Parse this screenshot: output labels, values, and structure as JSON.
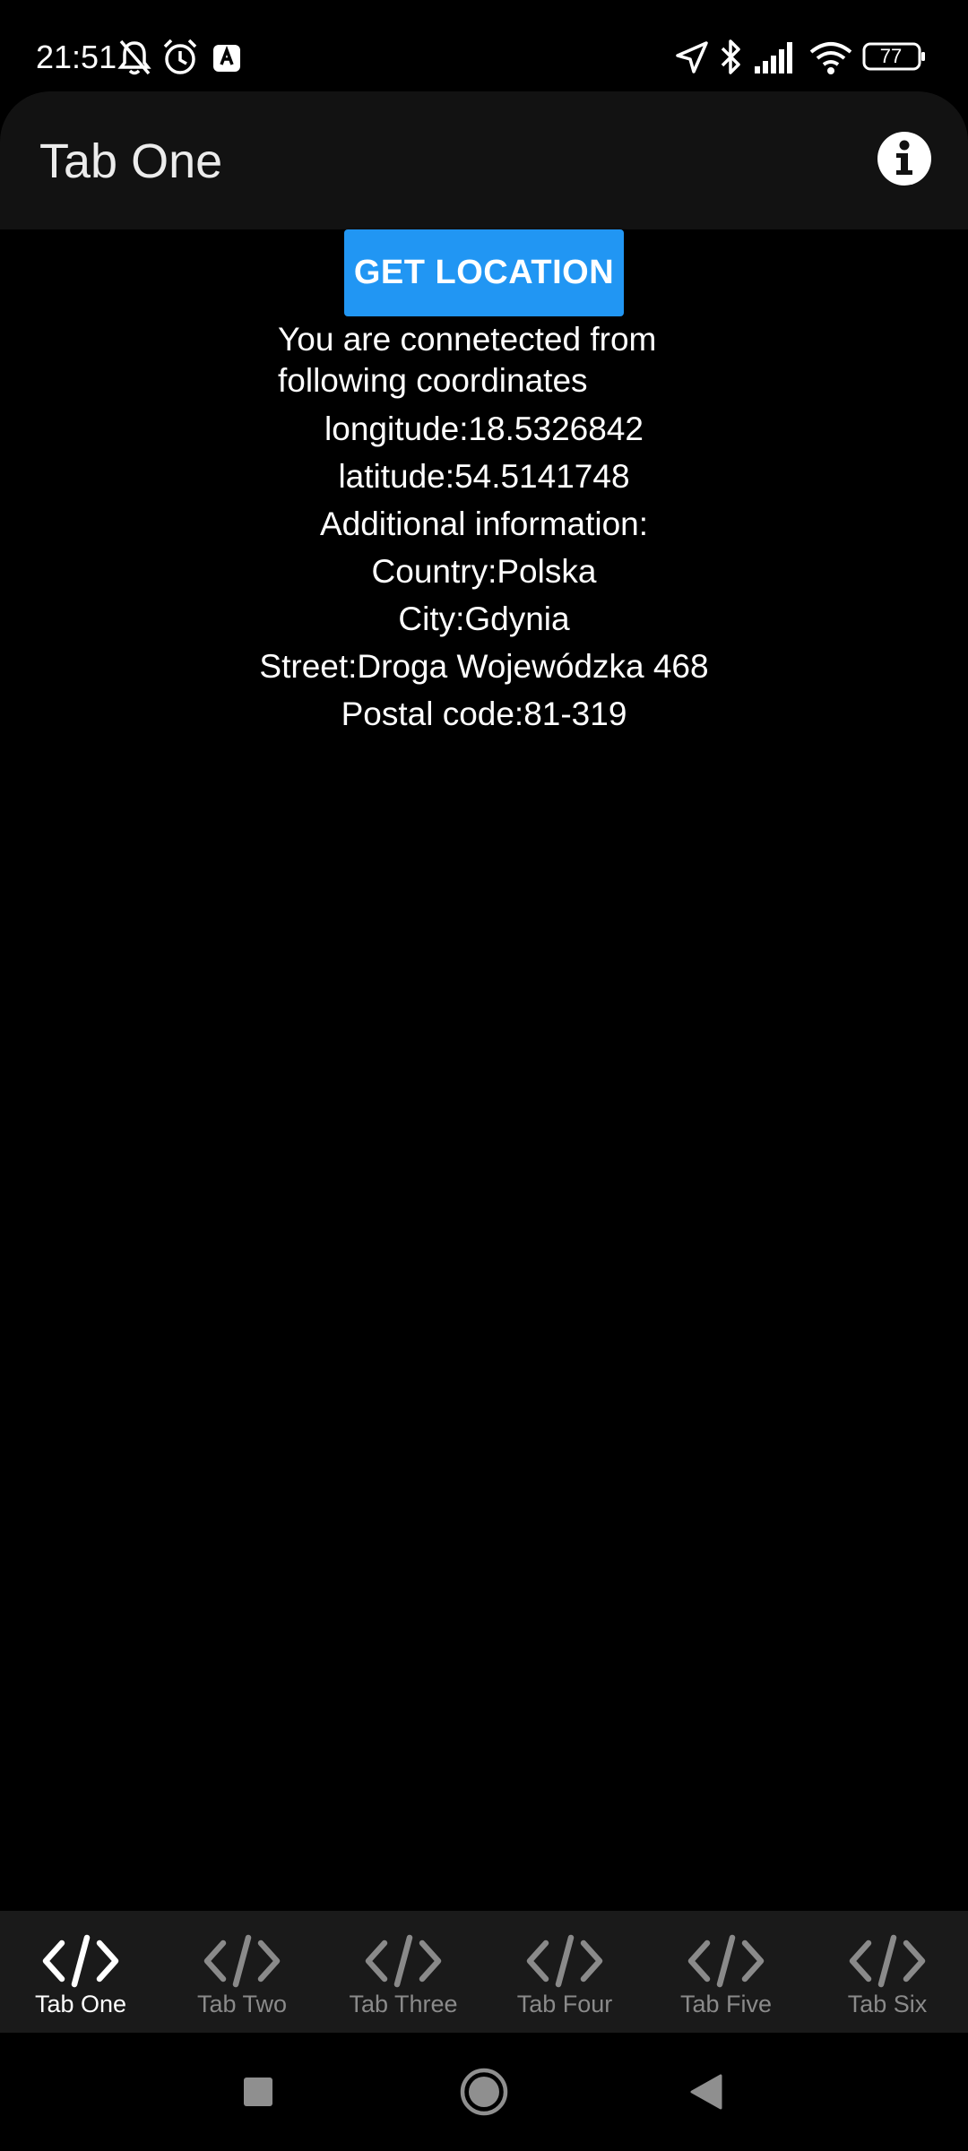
{
  "status_bar": {
    "time": "21:51",
    "battery_level": "77",
    "icons": [
      "bell-off-icon",
      "alarm-icon",
      "app-notification-icon",
      "location-arrow-icon",
      "bluetooth-icon",
      "signal-icon",
      "wifi-icon",
      "battery-icon"
    ]
  },
  "app_bar": {
    "title": "Tab One",
    "info_icon": "info-icon"
  },
  "main": {
    "get_location_label": "GET LOCATION",
    "connected_text": "You are connetected from following coordinates",
    "longitude": "longitude:18.5326842",
    "latitude": "latitude:54.5141748",
    "additional_info": "Additional information:",
    "country": "Country:Polska",
    "city": "City:Gdynia",
    "street": "Street:Droga Wojewódzka 468",
    "postal_code": "Postal code:81-319"
  },
  "tabs": [
    {
      "label": "Tab One",
      "icon": "code-icon",
      "active": true
    },
    {
      "label": "Tab Two",
      "icon": "code-icon",
      "active": false
    },
    {
      "label": "Tab Three",
      "icon": "code-icon",
      "active": false
    },
    {
      "label": "Tab Four",
      "icon": "code-icon",
      "active": false
    },
    {
      "label": "Tab Five",
      "icon": "code-icon",
      "active": false
    },
    {
      "label": "Tab Six",
      "icon": "code-icon",
      "active": false
    }
  ],
  "nav_bar": {
    "buttons": [
      "recents-square-icon",
      "home-circle-icon",
      "back-triangle-icon"
    ]
  },
  "colors": {
    "accent": "#2196f3",
    "app_bar_bg": "#121212",
    "tab_bar_bg": "#1a1a1a",
    "inactive_tab": "#8a8a8a",
    "background": "#000000"
  }
}
